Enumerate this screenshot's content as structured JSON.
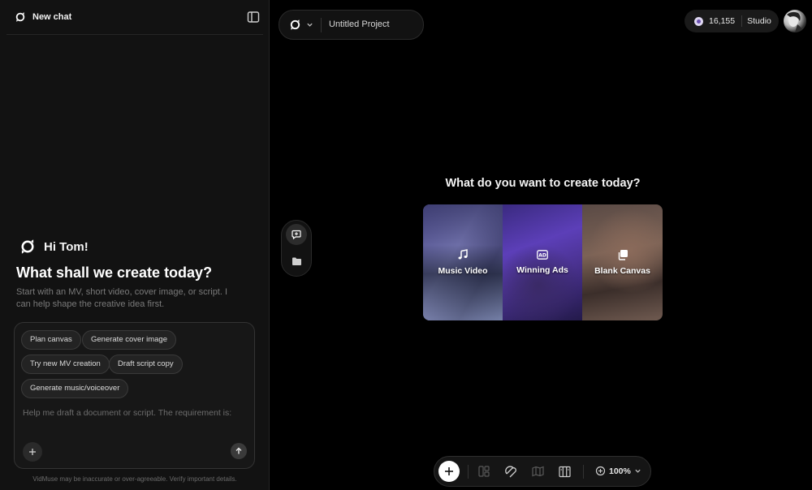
{
  "sidebar": {
    "new_chat_label": "New chat",
    "greeting": "Hi Tom!",
    "headline": "What shall we create today?",
    "subtext": "Start with an MV, short video, cover image, or script. I can help shape the creative idea first.",
    "chips": [
      "Plan canvas",
      "Generate cover image",
      "Try new MV creation",
      "Draft script copy",
      "Generate music/voiceover"
    ],
    "prompt_value": "Help me draft a document or script. The requirement is:",
    "disclaimer": "VidMuse may be inaccurate or over-agreeable. Verify important details."
  },
  "topbar": {
    "project_name": "Untitled Project",
    "credits": "16,155",
    "studio_label": "Studio"
  },
  "main": {
    "title": "What do you want to create today?",
    "cards": [
      {
        "label": "Music Video",
        "icon": "music-note-icon"
      },
      {
        "label": "Winning Ads",
        "icon": "ad-badge-icon"
      },
      {
        "label": "Blank Canvas",
        "icon": "copy-icon"
      }
    ]
  },
  "toolbar": {
    "zoom": "100%",
    "icons": [
      "add-icon",
      "layout-icon",
      "magnet-icon",
      "map-icon",
      "columns-icon",
      "zoom-icon",
      "chevron-down-icon"
    ]
  },
  "colors": {
    "background": "#000000",
    "sidebar_bg": "#121212",
    "border": "#2a2a2a",
    "muted_text": "#7a7a7a",
    "ads_card": "#5c3fb8"
  }
}
